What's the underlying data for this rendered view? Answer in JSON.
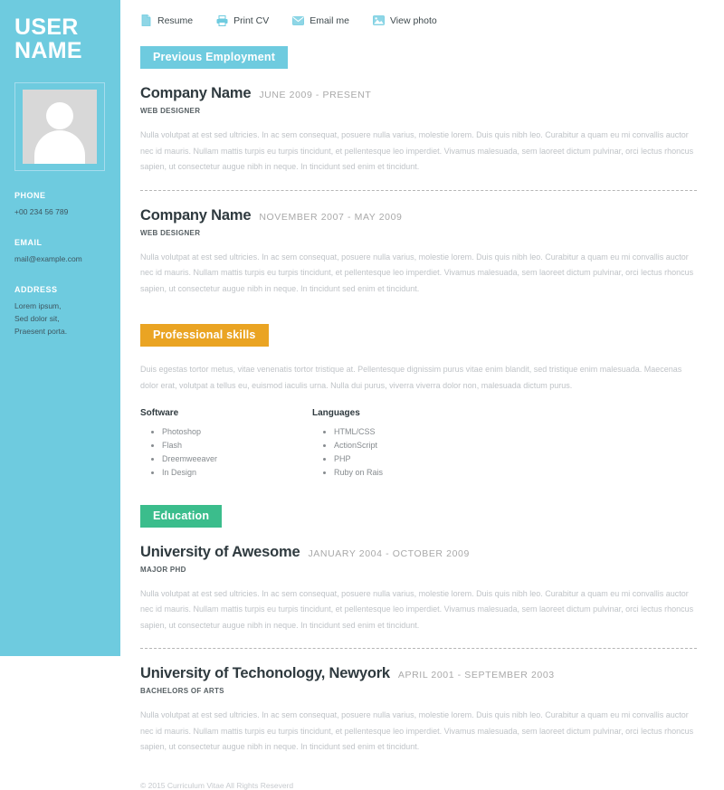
{
  "colors": {
    "sidebar": "#6ecbdf",
    "teal": "#6ecbdf",
    "orange": "#eaa423",
    "green": "#3bbd8c"
  },
  "sidebar": {
    "name_line1": "USER",
    "name_line2": "NAME",
    "photo_icon": "avatar-placeholder",
    "contacts": [
      {
        "label": "PHONE",
        "value": "+00 234 56 789"
      },
      {
        "label": "EMAIL",
        "value": "mail@example.com"
      }
    ],
    "address_label": "ADDRESS",
    "address_lines": [
      "Lorem ipsum,",
      "Sed dolor sit,",
      "Praesent porta."
    ]
  },
  "toolbar": {
    "items": [
      {
        "label": "Resume",
        "icon": "document-icon"
      },
      {
        "label": "Print CV",
        "icon": "printer-icon"
      },
      {
        "label": "Email me",
        "icon": "envelope-icon"
      },
      {
        "label": "View photo",
        "icon": "image-icon"
      }
    ]
  },
  "sections": {
    "employment": {
      "title": "Previous Employment",
      "entries": [
        {
          "title": "Company Name",
          "dates": "JUNE 2009 - PRESENT",
          "role": "WEB DESIGNER",
          "body": "Nulla volutpat at est sed ultricies. In ac sem consequat, posuere nulla varius, molestie lorem. Duis quis nibh leo. Curabitur a quam eu mi convallis auctor nec id mauris. Nullam mattis turpis eu turpis tincidunt, et pellentesque leo imperdiet. Vivamus malesuada, sem laoreet dictum pulvinar, orci lectus rhoncus sapien, ut consectetur augue nibh in neque. In tincidunt sed enim et tincidunt."
        },
        {
          "title": "Company Name",
          "dates": "NOVEMBER 2007 - MAY 2009",
          "role": "WEB DESIGNER",
          "body": "Nulla volutpat at est sed ultricies. In ac sem consequat, posuere nulla varius, molestie lorem. Duis quis nibh leo. Curabitur a quam eu mi convallis auctor nec id mauris. Nullam mattis turpis eu turpis tincidunt, et pellentesque leo imperdiet. Vivamus malesuada, sem laoreet dictum pulvinar, orci lectus rhoncus sapien, ut consectetur augue nibh in neque. In tincidunt sed enim et tincidunt."
        }
      ]
    },
    "skills": {
      "title": "Professional skills",
      "intro": "Duis egestas tortor metus, vitae venenatis tortor tristique at. Pellentesque dignissim purus vitae enim blandit, sed tristique enim malesuada. Maecenas dolor erat, volutpat a tellus eu, euismod iaculis urna. Nulla dui purus, viverra viverra dolor non, malesuada dictum purus.",
      "columns": [
        {
          "title": "Software",
          "items": [
            "Photoshop",
            "Flash",
            "Dreemweeaver",
            "In Design"
          ]
        },
        {
          "title": "Languages",
          "items": [
            "HTML/CSS",
            "ActionScript",
            "PHP",
            "Ruby on Rais"
          ]
        }
      ]
    },
    "education": {
      "title": "Education",
      "entries": [
        {
          "title": "University of Awesome",
          "dates": "JANUARY 2004 - OCTOBER 2009",
          "role": "MAJOR PHD",
          "body": "Nulla volutpat at est sed ultricies. In ac sem consequat, posuere nulla varius, molestie lorem. Duis quis nibh leo. Curabitur a quam eu mi convallis auctor nec id mauris. Nullam mattis turpis eu turpis tincidunt, et pellentesque leo imperdiet. Vivamus malesuada, sem laoreet dictum pulvinar, orci lectus rhoncus sapien, ut consectetur augue nibh in neque. In tincidunt sed enim et tincidunt."
        },
        {
          "title": "University of Techonology, Newyork",
          "dates": "APRIL 2001 - SEPTEMBER 2003",
          "role": "BACHELORS OF ARTS",
          "body": "Nulla volutpat at est sed ultricies. In ac sem consequat, posuere nulla varius, molestie lorem. Duis quis nibh leo. Curabitur a quam eu mi convallis auctor nec id mauris. Nullam mattis turpis eu turpis tincidunt, et pellentesque leo imperdiet. Vivamus malesuada, sem laoreet dictum pulvinar, orci lectus rhoncus sapien, ut consectetur augue nibh in neque. In tincidunt sed enim et tincidunt."
        }
      ]
    }
  },
  "footer": {
    "copyright": "© 2015 Curriculum Vitae All Rights Reseverd"
  }
}
